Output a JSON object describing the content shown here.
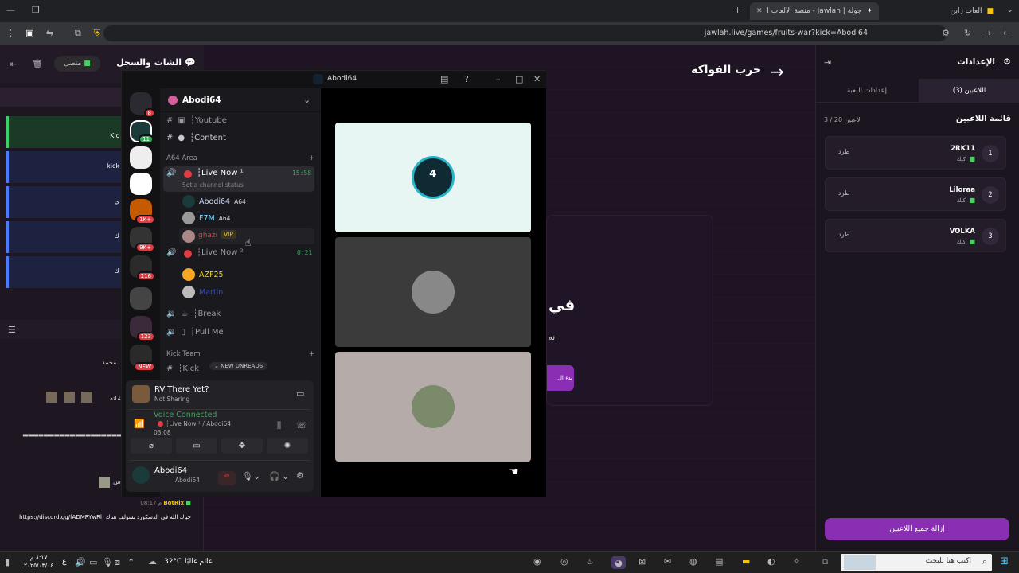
{
  "browser": {
    "tabs": [
      {
        "label": "جولة | Jawlah - منصة الألعاب الت",
        "active": true
      },
      {
        "label": "العاب زابن",
        "active": false
      }
    ],
    "url": "jawlah.live/games/fruits-war?kick=Abodi64"
  },
  "left_panel": {
    "title": "الشات والسجل",
    "status": "متصل",
    "messages": [
      {
        "text": "Kic"
      },
      {
        "text": "kick"
      },
      {
        "text": "ي"
      },
      {
        "text": "ك"
      },
      {
        "text": "ك"
      }
    ],
    "chat_lines": [
      {
        "text": "محمد"
      },
      {
        "text": "مع شاته"
      },
      {
        "text": "▬▬▬▬▬▬▬▬▬▬▬▬▬▬▬▬▬▬▬▬▬"
      },
      {
        "text": "س"
      }
    ],
    "bot": {
      "time": "08:17 م",
      "name": "BotRix",
      "message": "https://discord.gg/fADMRYwRh حياك الله في الدسكورد تسولف هناك"
    }
  },
  "game": {
    "title": "حرب الفواكه",
    "center_text_1": "في",
    "center_text_2": "انه",
    "start_button": "بدء ال"
  },
  "settings": {
    "title": "الإعدادات",
    "tabs": [
      {
        "label": "اللاعبين (3)",
        "active": true
      },
      {
        "label": "إعدادات اللعبة",
        "active": false
      }
    ],
    "list_title": "قائمة اللاعبين",
    "count": "3 / 20 لاعبين",
    "players": [
      {
        "rank": "1",
        "name": "2RK11",
        "platform": "كيك",
        "action": "طرد"
      },
      {
        "rank": "2",
        "name": "Liloraa",
        "platform": "كيك",
        "action": "طرد"
      },
      {
        "rank": "3",
        "name": "VOLKA",
        "platform": "كيك",
        "action": "طرد"
      }
    ],
    "remove_all": "إزالة جميع اللاعبين"
  },
  "discord": {
    "window_title": "Abodi64",
    "server_name": "Abodi64",
    "guild_badges": [
      "8",
      "11",
      "1K+",
      "9K+",
      "116",
      "123",
      "NEW"
    ],
    "channels_top": [
      {
        "name": "┆Youtube"
      },
      {
        "name": "┆Content"
      }
    ],
    "category_1": "A64 Area",
    "live_now_1": {
      "name": "┆Live Now ¹",
      "time": "15:58",
      "status": "Set a channel status"
    },
    "members_1": [
      {
        "name": "Abodi64",
        "tag": "A64",
        "color": "#cfd9ff"
      },
      {
        "name": "F7M",
        "tag": "A64",
        "color": "#7fd3ff"
      },
      {
        "name": "ghazi",
        "tag": "VIP",
        "color": "#e33a3a"
      }
    ],
    "live_now_2": {
      "name": "┆Live Now ²",
      "time": "0:21"
    },
    "members_2": [
      {
        "name": "AZF25",
        "color": "#f5d60a"
      },
      {
        "name": "Martin",
        "color": "#2c4bd8"
      }
    ],
    "voice_channels": [
      {
        "name": "┆Break"
      },
      {
        "name": "┆Pull Me"
      }
    ],
    "category_2": "Kick Team",
    "kick_channel": "┆Kick",
    "new_unreads": "NEW UNREADS",
    "activity": {
      "title": "RV There Yet?",
      "sub": "Not Sharing"
    },
    "voice": {
      "label": "Voice Connected",
      "channel": "┆Live Now ¹ / Abodi64",
      "time": "03:08"
    },
    "user": {
      "name": "Abodi64",
      "sub": "Abodi64"
    }
  },
  "taskbar": {
    "time": "٨:١٧ م",
    "date": "٢٠٢٥/٠٣/٠٤",
    "lang": "ع",
    "temp": "32°C",
    "weather": "غائم غالبًا",
    "search": "اكتب هنا للبحث"
  }
}
